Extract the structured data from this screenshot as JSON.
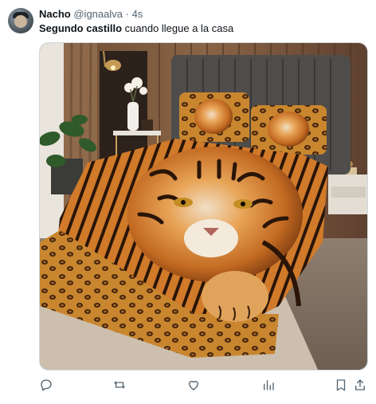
{
  "tweet": {
    "name": "Nacho",
    "handle": "@ignaalva",
    "separator": "·",
    "time": "4s",
    "text_bold": "Segundo castillo",
    "text_rest": " cuando llegue a la casa",
    "media_description_icon": "photo"
  },
  "actions": {
    "reply": "reply-icon",
    "retweet": "retweet-icon",
    "like": "heart-icon",
    "views": "views-icon",
    "bookmark": "bookmark-icon",
    "share": "share-icon"
  },
  "colors": {
    "text": "#0f1419",
    "secondary": "#536471",
    "border": "#cfd9de"
  }
}
